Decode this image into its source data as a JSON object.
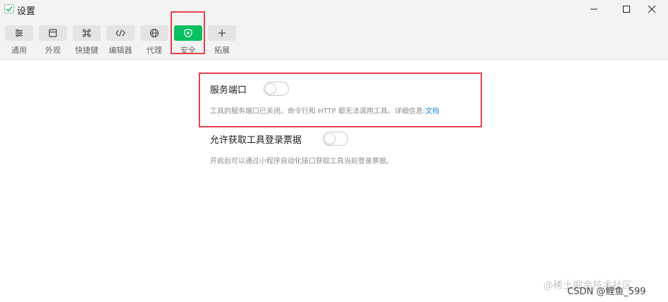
{
  "window": {
    "title": "设置"
  },
  "toolbar": {
    "tabs": [
      {
        "label": "通用",
        "icon": "sliders-icon"
      },
      {
        "label": "外观",
        "icon": "layout-icon"
      },
      {
        "label": "快捷键",
        "icon": "command-key-icon"
      },
      {
        "label": "编辑器",
        "icon": "code-icon"
      },
      {
        "label": "代理",
        "icon": "globe-icon"
      },
      {
        "label": "安全",
        "icon": "shield-icon",
        "active": true
      },
      {
        "label": "拓展",
        "icon": "plus-icon"
      }
    ]
  },
  "settings": {
    "service_port": {
      "title": "服务端口",
      "enabled": false,
      "desc": "工具的服务端口已关闭。命令行和 HTTP 都无法调用工具。详细信息:",
      "link": "文档"
    },
    "login_ticket": {
      "title": "允许获取工具登录票据",
      "enabled": false,
      "desc": "开启后可以通过小程序自动化接口获取工具当前登录票据。"
    }
  },
  "overlay": {
    "watermark": "@稀土掘金技术社区",
    "credit": "CSDN @鲤鱼_599"
  },
  "colors": {
    "accent": "#07c160",
    "annotation": "#e5404f",
    "link": "#1e8ad6"
  }
}
